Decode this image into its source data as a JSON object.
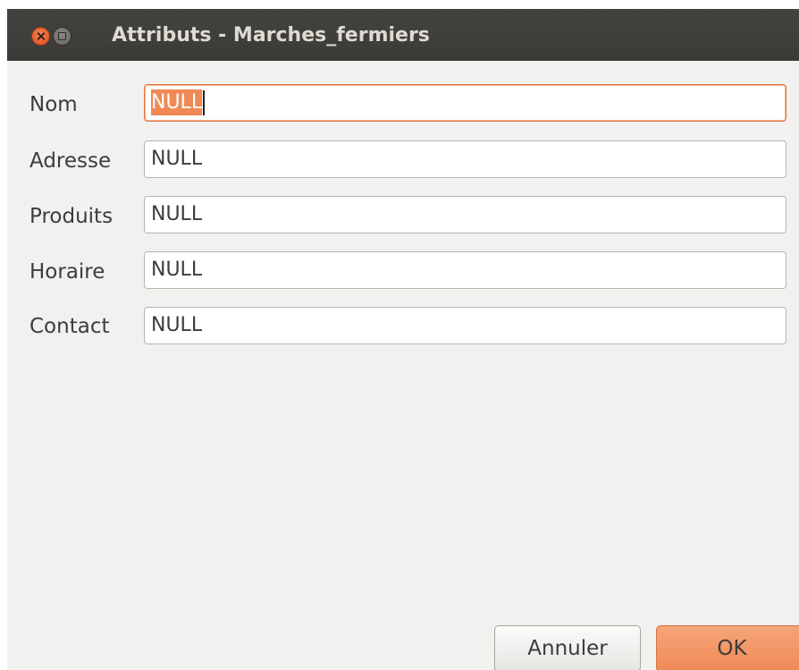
{
  "window": {
    "title": "Attributs - Marches_fermiers",
    "controls": [
      "close-icon",
      "maximize-icon"
    ]
  },
  "fields": [
    {
      "label": "Nom",
      "value": "NULL",
      "focused": true,
      "selected": true
    },
    {
      "label": "Adresse",
      "value": "NULL"
    },
    {
      "label": "Produits",
      "value": "NULL"
    },
    {
      "label": "Horaire",
      "value": "NULL"
    },
    {
      "label": "Contact",
      "value": "NULL"
    }
  ],
  "buttons": {
    "cancel_label": "Annuler",
    "ok_label": "OK"
  },
  "colors": {
    "titlebar": "#3c3b37",
    "accent": "#f08a55",
    "background": "#f2f1f0"
  }
}
